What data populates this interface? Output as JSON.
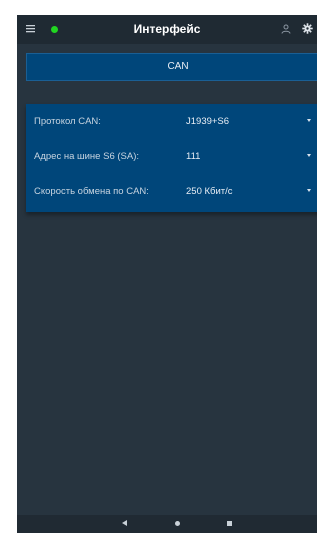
{
  "app": {
    "title": "Интерфейс",
    "status_color": "#21d521",
    "icons": {
      "menu": "menu-icon",
      "status": "status-dot",
      "user": "user-icon",
      "settings": "gear-icon"
    }
  },
  "tabs": [
    {
      "label": "CAN",
      "selected": true
    }
  ],
  "settings": {
    "rows": [
      {
        "label": "Протокол CAN:",
        "value": "J1939+S6"
      },
      {
        "label": "Адрес на шине S6 (SA):",
        "value": "111"
      },
      {
        "label": "Скорость обмена по CAN:",
        "value": "250 Кбит/с"
      }
    ]
  },
  "navbar": {
    "icons": [
      "back-icon",
      "home-icon",
      "recent-apps-icon"
    ]
  }
}
